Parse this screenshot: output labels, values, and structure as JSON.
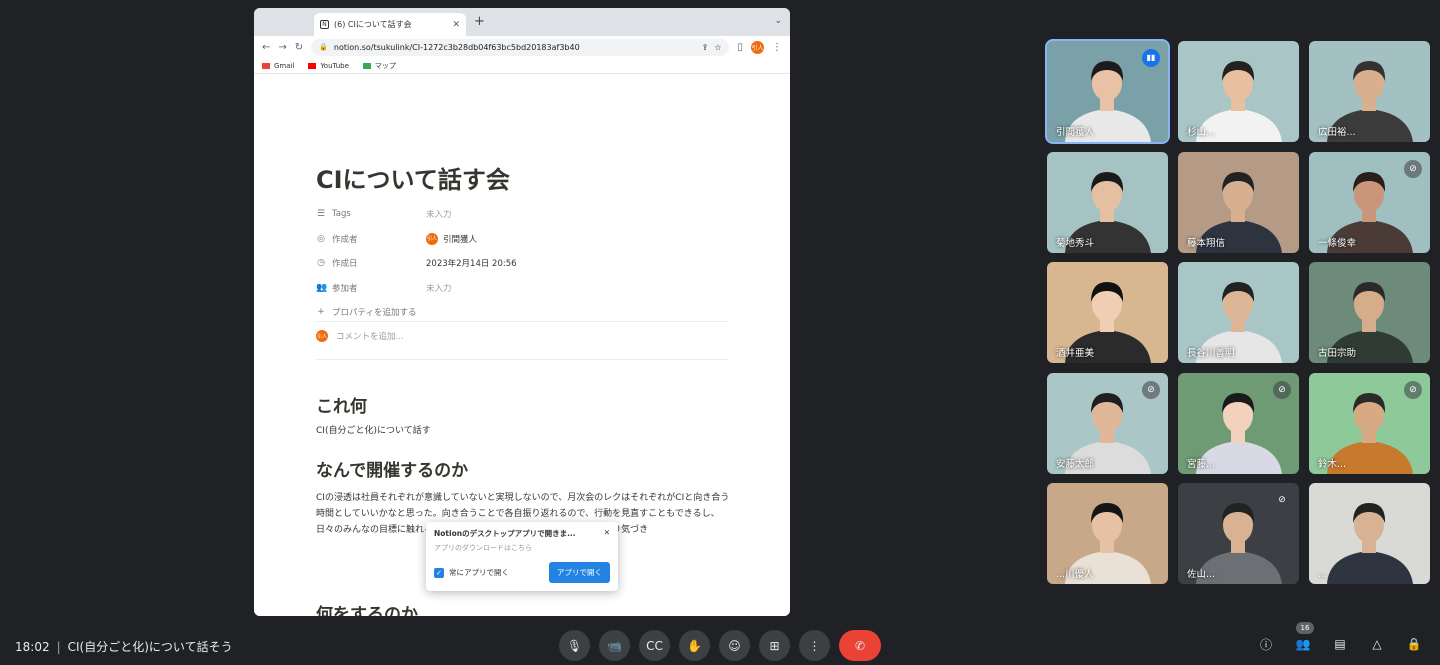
{
  "browser": {
    "tab_title": "(6) CIについて話す会",
    "tab_favicon": "N",
    "url": "notion.so/tsukulink/CI-1272c3b28db04f63bc5bd20183af3b40",
    "profile_initials": "引人",
    "bookmarks": [
      {
        "label": "Gmail",
        "icon": "gmail-icon",
        "color": "#ea4335"
      },
      {
        "label": "YouTube",
        "icon": "youtube-icon",
        "color": "#ff0000"
      },
      {
        "label": "マップ",
        "icon": "maps-icon",
        "color": "#34a853"
      }
    ]
  },
  "doc": {
    "title": "CIについて話す会",
    "properties": [
      {
        "key": "Tags",
        "icon": "list-icon",
        "value": "未入力",
        "empty": true
      },
      {
        "key": "作成者",
        "icon": "person-icon",
        "value": "引間獲人",
        "avatar": "引人",
        "empty": false
      },
      {
        "key": "作成日",
        "icon": "clock-icon",
        "value": "2023年2月14日 20:56",
        "empty": false
      },
      {
        "key": "参加者",
        "icon": "people-icon",
        "value": "未入力",
        "empty": true
      }
    ],
    "add_property": "プロパティを追加する",
    "comment_placeholder": "コメントを追加...",
    "comment_avatar": "引人",
    "sections": [
      {
        "heading": "これ何",
        "body": "CI(自分ごと化)について話す"
      },
      {
        "heading": "なんで開催するのか",
        "body": "CIの浸透は社員それぞれが意識していないと実現しないので、月次会のレクはそれぞれがCIと向き合う時間としていいかなと思った。向き合うことで各自振り返れるので、行動を見直すこともできるし、日々のみんなの目標に触れることでみんなで共有・思考しあったほうがより気づき"
      },
      {
        "heading": "何をするのか",
        "body": ""
      }
    ],
    "popup": {
      "title": "Notionのデスクトップアプリで開きま...",
      "subtitle": "アプリのダウンロードはこちら",
      "checkbox_label": "常にアプリで開く",
      "open_button": "アプリで開く"
    }
  },
  "participants": [
    {
      "name": "引間獲人",
      "bg": "#7aa0a8",
      "skin": "#e9c1a5",
      "hair": "#1c1c1c",
      "shirt": "#e8e8e8",
      "active": true,
      "status": "speaking"
    },
    {
      "name": "杉山...",
      "bg": "#a9c5c5",
      "skin": "#e8c09f",
      "hair": "#222",
      "shirt": "#f2f2f2",
      "active": false,
      "status": ""
    },
    {
      "name": "広田裕...",
      "bg": "#a3c1c3",
      "skin": "#d9b08f",
      "hair": "#333",
      "shirt": "#3b3b3b",
      "active": false,
      "status": ""
    },
    {
      "name": "菊地秀斗",
      "bg": "#a6c3c4",
      "skin": "#e5bfa1",
      "hair": "#1a1a1a",
      "shirt": "#333",
      "active": false,
      "status": ""
    },
    {
      "name": "藤本翔信",
      "bg": "#b59a85",
      "skin": "#d7b092",
      "hair": "#222",
      "shirt": "#2d3440",
      "active": false,
      "status": ""
    },
    {
      "name": "一條俊幸",
      "bg": "#9fbfc1",
      "skin": "#c9967a",
      "hair": "#2a1e1a",
      "shirt": "#4a3b36",
      "active": false,
      "status": "muted"
    },
    {
      "name": "酒井亜美",
      "bg": "#d8b690",
      "skin": "#f0cdb4",
      "hair": "#111",
      "shirt": "#2b2b2b",
      "active": false,
      "status": ""
    },
    {
      "name": "長谷川善明",
      "bg": "#a9c6c6",
      "skin": "#dcb696",
      "hair": "#222",
      "shirt": "#e6e6e6",
      "active": false,
      "status": ""
    },
    {
      "name": "古田宗助",
      "bg": "#6d8a7a",
      "skin": "#d6ad8a",
      "hair": "#2a2a2a",
      "shirt": "#2f3b33",
      "active": false,
      "status": ""
    },
    {
      "name": "安藤太郎",
      "bg": "#aac6c7",
      "skin": "#e1b79a",
      "hair": "#1f1f1f",
      "shirt": "#dcdcdc",
      "active": false,
      "status": "muted"
    },
    {
      "name": "宮藤...",
      "bg": "#6e9a74",
      "skin": "#f2d2bd",
      "hair": "#1a1a1a",
      "shirt": "#d9d9e6",
      "active": false,
      "status": "muted"
    },
    {
      "name": "鈴木...",
      "bg": "#8ec99a",
      "skin": "#d8aa83",
      "hair": "#2a2a2a",
      "shirt": "#c77a2e",
      "active": false,
      "status": "muted"
    },
    {
      "name": "...川優人",
      "bg": "#c7a889",
      "skin": "#e7c1a4",
      "hair": "#151515",
      "shirt": "#e9e0d6",
      "active": false,
      "status": ""
    },
    {
      "name": "佐山...",
      "bg": "#3c3f43",
      "skin": "#d9b294",
      "hair": "#222",
      "shirt": "#6c6f73",
      "active": false,
      "status": "muted"
    },
    {
      "name": "...",
      "bg": "#d9d9d6",
      "skin": "#d8b295",
      "hair": "#222",
      "shirt": "#2e3440",
      "active": false,
      "status": ""
    }
  ],
  "meeting": {
    "time": "18:02",
    "title": "CI(自分ごと化)について話そう",
    "controls": [
      {
        "name": "mic-button",
        "icon": "🎙"
      },
      {
        "name": "camera-button",
        "icon": "📹"
      },
      {
        "name": "captions-button",
        "icon": "CC"
      },
      {
        "name": "raise-hand-button",
        "icon": "✋"
      },
      {
        "name": "emoji-button",
        "icon": "☺"
      },
      {
        "name": "present-button",
        "icon": "⊞"
      },
      {
        "name": "more-options-button",
        "icon": "⋮"
      }
    ],
    "end_call_icon": "✆",
    "people_count": "16",
    "right_controls": [
      {
        "name": "meeting-details-button",
        "icon": "ⓘ"
      },
      {
        "name": "people-button",
        "icon": "👥"
      },
      {
        "name": "chat-button",
        "icon": "▤"
      },
      {
        "name": "activities-button",
        "icon": "△"
      },
      {
        "name": "host-controls-button",
        "icon": "🔒"
      }
    ]
  }
}
